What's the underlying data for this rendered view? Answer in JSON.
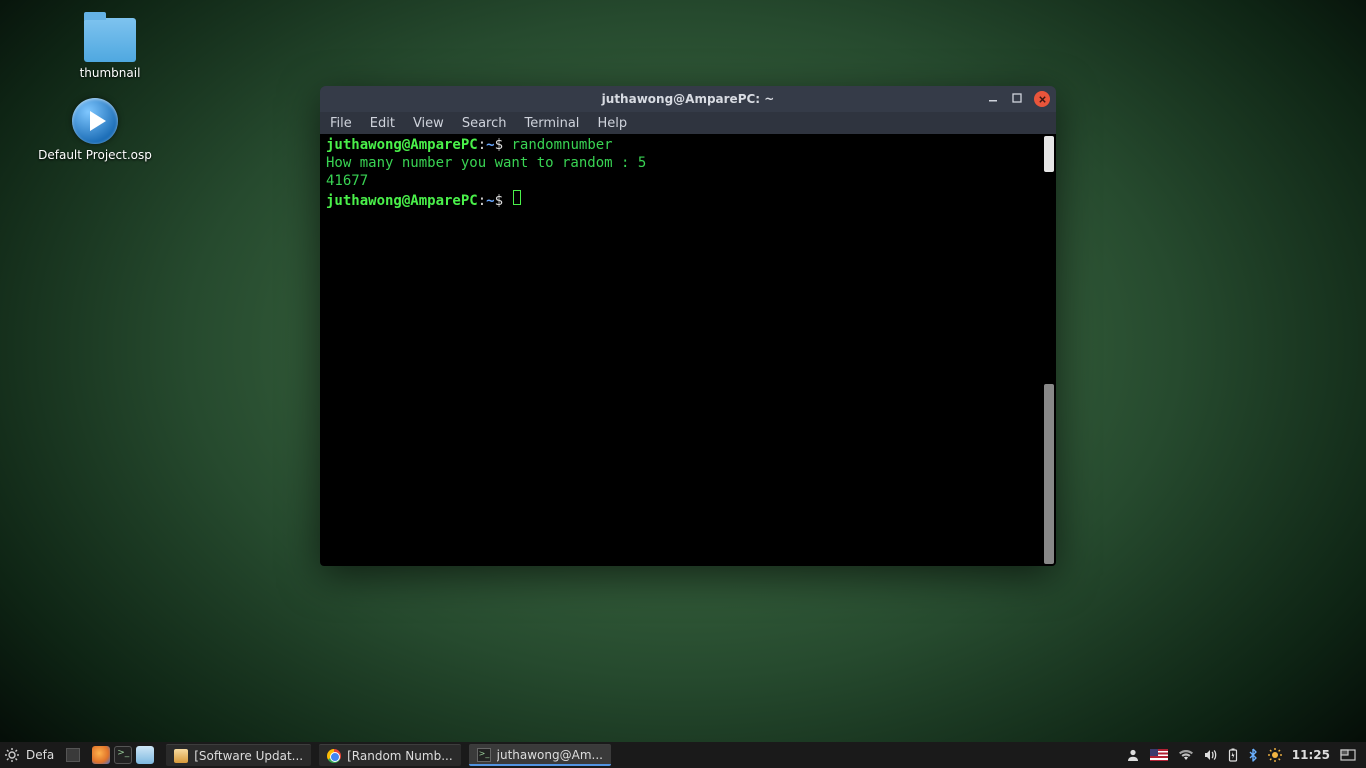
{
  "desktop": {
    "icons": [
      {
        "name": "thumbnail",
        "label": "thumbnail",
        "kind": "folder"
      },
      {
        "name": "default-project",
        "label": "Default Project.osp",
        "kind": "play"
      }
    ]
  },
  "window": {
    "title": "juthawong@AmparePC: ~",
    "menu": [
      "File",
      "Edit",
      "View",
      "Search",
      "Terminal",
      "Help"
    ],
    "prompt_user": "juthawong@AmparePC",
    "prompt_path": "~",
    "prompt_symbol": "$",
    "lines": {
      "cmd1": "randomnumber",
      "out1": "How many number you want to random : 5",
      "out2": "41677"
    }
  },
  "taskbar": {
    "menu_label": "Defa",
    "buttons": [
      {
        "id": "software-updater",
        "label": "[Software Updat...",
        "icon": "upd",
        "active": false
      },
      {
        "id": "random-number",
        "label": "[Random Numb...",
        "icon": "chrome",
        "active": false
      },
      {
        "id": "terminal",
        "label": "juthawong@Am...",
        "icon": "term",
        "active": true
      }
    ],
    "clock": "11:25"
  }
}
